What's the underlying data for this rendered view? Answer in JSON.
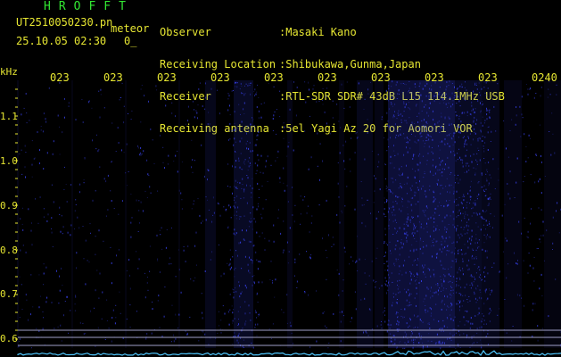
{
  "header": {
    "app_title": "HROFFT",
    "file_name": "UT2510050230.pn",
    "mode_label": "meteor",
    "datetime": "25.10.05 02:30",
    "count": "0_"
  },
  "info": {
    "labels": [
      "Observer",
      "Receiving Location",
      "Receiver",
      "Receiving antenna"
    ],
    "values": [
      ":Masaki Kano",
      ":Shibukawa,Gunma,Japan",
      ":RTL-SDR SDR# 43dB L15 114.1MHz USB",
      ":5el Yagi Az 20 for Aomori VOR"
    ]
  },
  "axes": {
    "unit": "kHz",
    "time_ticks": [
      "023",
      "023",
      "023",
      "023",
      "023",
      "023",
      "023",
      "023",
      "023",
      "0240"
    ],
    "freq_ticks": [
      "1.1",
      "1.0",
      "0.9",
      "0.8",
      "0.7",
      "0.6"
    ]
  },
  "colors": {
    "background": "#000000",
    "label_yellow": "#e6e632",
    "title_green": "#32e632",
    "signal_blue": "#3c46ff",
    "marker_line": "#a0a0c8",
    "baseline_cyan": "#50c8ff"
  }
}
